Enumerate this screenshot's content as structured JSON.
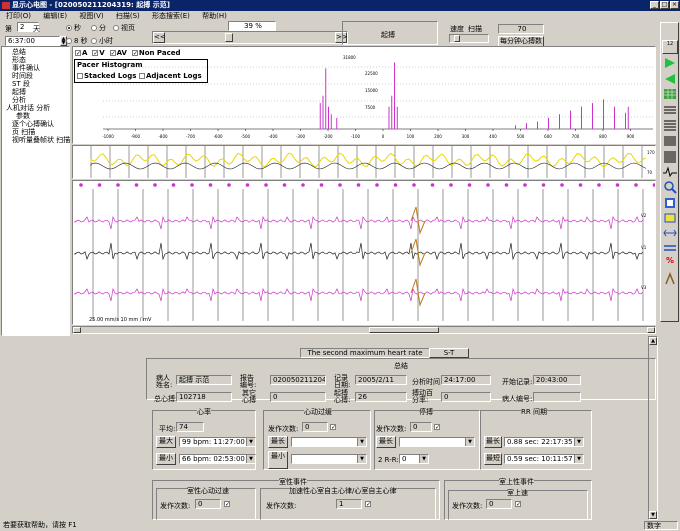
{
  "title": "显示心电图 - [020050211204319: 起搏 示范]",
  "menu": [
    "打印(O)",
    "编辑(E)",
    "视图(V)",
    "扫描(S)",
    "形态搜索(E)",
    "帮助(H)"
  ],
  "controls": {
    "prefix_label": "第",
    "day_value": "2",
    "day_unit": "天",
    "time_value": "6:37:00",
    "radio_sec": "秒",
    "radio_min": "分",
    "radio_page": "视页",
    "radio_8sec": "8 秒",
    "radio_hour": "小时",
    "percent": "39 %",
    "nav_back": "<<",
    "nav_fwd": ">>",
    "pacing_label": "起搏",
    "speed_label": "速度",
    "scan_label": "扫描",
    "speed_value": "70",
    "rate_label": "每分钟心搏数"
  },
  "tree": [
    "总结",
    "形态",
    "事件确认",
    "时间段",
    "ST 段",
    "起搏",
    "分析",
    "人机对话 分析",
    "参数",
    "逐个心搏确认",
    "页 扫描",
    "视听量叠帧状 扫描"
  ],
  "histogram": {
    "checks": [
      {
        "label": "A",
        "checked": true
      },
      {
        "label": "V",
        "checked": true
      },
      {
        "label": "AV",
        "checked": true
      },
      {
        "label": "Non Paced",
        "checked": true
      }
    ],
    "title": "Pacer Histogram",
    "stacked": "Stacked Logs",
    "adjacent": "Adjacent Logs",
    "x_ticks": [
      "-1000",
      "-900",
      "-800",
      "-700",
      "-600",
      "-500",
      "-400",
      "-300",
      "-200",
      "-100",
      "0",
      "100",
      "200",
      "300",
      "400",
      "500",
      "600",
      "700",
      "800",
      "900"
    ],
    "y_ticks": [
      "31800",
      "22500",
      "15000",
      "7500"
    ]
  },
  "trend": {
    "y_ticks": [
      "170",
      "70"
    ]
  },
  "ecg": {
    "scale": "25.00 mm/s 10 mm / mV",
    "leads": [
      "V2",
      "V1",
      "V3"
    ]
  },
  "bottom": {
    "tab": "The second maximum heart rate",
    "st_button": "S-T",
    "summary_title": "总结",
    "patient_name_label": "病人姓名:",
    "patient_name": "起搏 示范",
    "report_no_label": "报告编号:",
    "report_no": "020050211204319",
    "record_date_label": "记录日期:",
    "record_date": "2005/2/11",
    "analysis_time_label": "分析时间",
    "analysis_time": "24:17:00",
    "start_label": "开始记录:",
    "start_time": "20:43:00",
    "total_beats_label": "总心搏:",
    "total_beats": "102718",
    "other_beats_label": "其它心搏",
    "other_beats": "0",
    "paced_label": "起搏心搏:",
    "paced_beats": "26",
    "pacing_pct_label": "搏动百分率:",
    "pacing_pct": "0",
    "patient_no_label": "病人编号:",
    "patient_no": "",
    "hr": {
      "title": "心率",
      "avg_label": "平均:",
      "avg": "74",
      "max_button": "最大",
      "max_value": "99 bpm: 11:27:00 第2天",
      "min_button": "最小",
      "min_value": "66 bpm: 02:53:00 第2天"
    },
    "tachy": {
      "title": "心动过缓",
      "count_label": "发作次数:",
      "count": "0",
      "longest_button": "最长",
      "shortest_button": "最小"
    },
    "pause": {
      "title": "停搏",
      "count_label": "发作次数:",
      "count": "0",
      "longest_button": "最长",
      "rr_label": "2 R-R:",
      "rr_value": "0"
    },
    "rr": {
      "title": "RR 间期",
      "longest_button": "最长",
      "longest_value": "0.88 sec: 22:17:35 第1天",
      "shortest_button": "最短",
      "shortest_value": "0.59 sec: 10:11:57 第2天"
    },
    "ventricular_title": "室性事件",
    "vtach_title": "室性心动过速",
    "vtach_count_label": "发作次数:",
    "vtach_count": "0",
    "accel_title": "加速性心室自主心律/心室自主心律",
    "accel_count_label": "发作次数:",
    "accel_count": "1",
    "supra_title": "室上性事件",
    "supra_sub": "室上速",
    "supra_count_label": "发作次数:",
    "supra_count": "0"
  },
  "status": {
    "text": "若要获取帮助，请按 F1",
    "right": "数字"
  },
  "colors": {
    "pink": "#cc33cc",
    "yellow": "#e8d800",
    "dark": "#202020",
    "orange": "#c07a1a",
    "titlebar": "#0a246a"
  }
}
